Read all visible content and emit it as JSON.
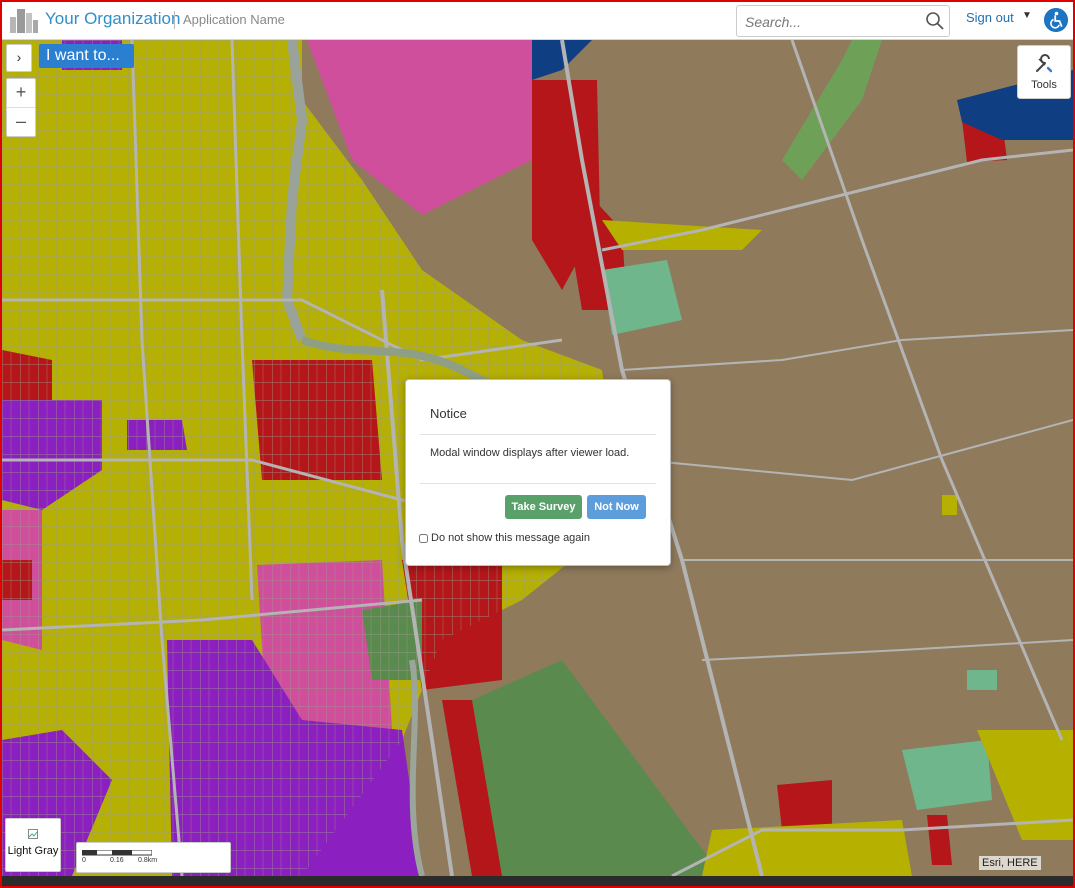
{
  "header": {
    "org_name": "Your Organization",
    "app_name": "Application Name",
    "search_placeholder": "Search...",
    "sign_out_label": "Sign out"
  },
  "map": {
    "i_want_to_label": "I want to...",
    "panel_toggle_glyph": "›",
    "zoom_in_glyph": "+",
    "zoom_out_glyph": "–",
    "tools_label": "Tools",
    "basemap_label": "Light Gray",
    "scale_labels": [
      "0",
      "0.16",
      "0.8km"
    ],
    "attribution": "Esri, HERE",
    "colors": {
      "background": "#8f7a5c",
      "residential_yellow": "#b6b000",
      "commercial_red": "#b5161a",
      "institutional_purple": "#8b1fbf",
      "pink": "#cf4f9d",
      "green": "#5b8a4f",
      "light_green": "#6fb68c",
      "navy": "#0f3e82",
      "roads": "#b4b4b4"
    }
  },
  "modal": {
    "title": "Notice",
    "body": "Modal window displays after viewer load.",
    "take_survey_label": "Take Survey",
    "not_now_label": "Not Now",
    "dont_show_label": "Do not show this message again"
  },
  "icons": [
    "org-logo-icon",
    "search-icon",
    "chevron-down-icon",
    "accessibility-icon",
    "tools-icon",
    "chevron-right-icon",
    "zoom-in-icon",
    "zoom-out-icon"
  ]
}
